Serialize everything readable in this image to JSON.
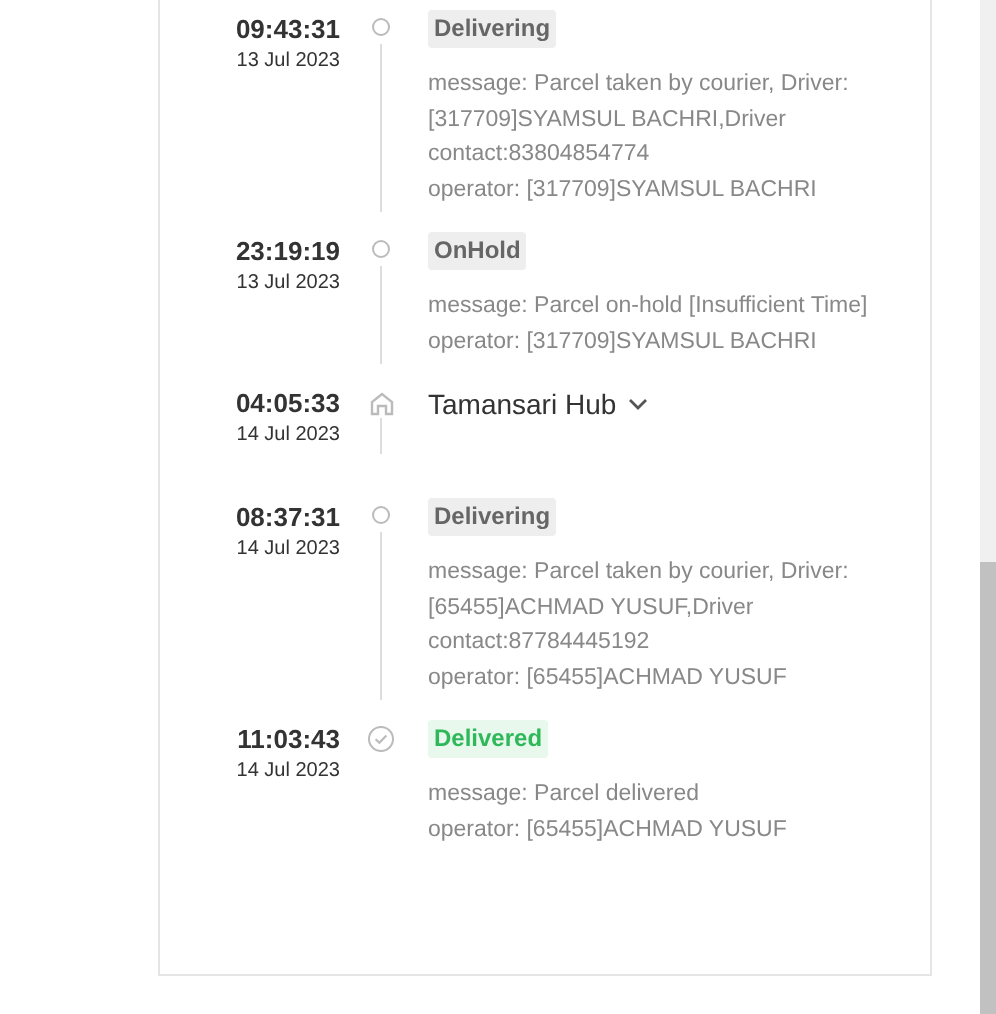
{
  "events": [
    {
      "kind": "status",
      "time": "09:43:31",
      "date": "13 Jul 2023",
      "status": "Delivering",
      "message_lines": [
        "message: Parcel taken by courier, Driver:",
        "[317709]SYAMSUL BACHRI,Driver",
        "contact:83804854774"
      ],
      "operator": "operator: [317709]SYAMSUL BACHRI"
    },
    {
      "kind": "status",
      "time": "23:19:19",
      "date": "13 Jul 2023",
      "status": "OnHold",
      "message_lines": [
        "message: Parcel on-hold [Insufficient Time]"
      ],
      "operator": "operator: [317709]SYAMSUL BACHRI"
    },
    {
      "kind": "hub",
      "time": "04:05:33",
      "date": "14 Jul 2023",
      "hub": "Tamansari Hub",
      "expanded": false
    },
    {
      "kind": "status",
      "time": "08:37:31",
      "date": "14 Jul 2023",
      "status": "Delivering",
      "message_lines": [
        "message: Parcel taken by courier, Driver:",
        "[65455]ACHMAD YUSUF,Driver",
        "contact:87784445192"
      ],
      "operator": "operator: [65455]ACHMAD YUSUF"
    },
    {
      "kind": "delivered",
      "time": "11:03:43",
      "date": "14 Jul 2023",
      "status": "Delivered",
      "message_lines": [
        "message: Parcel delivered"
      ],
      "operator": "operator: [65455]ACHMAD YUSUF"
    }
  ]
}
